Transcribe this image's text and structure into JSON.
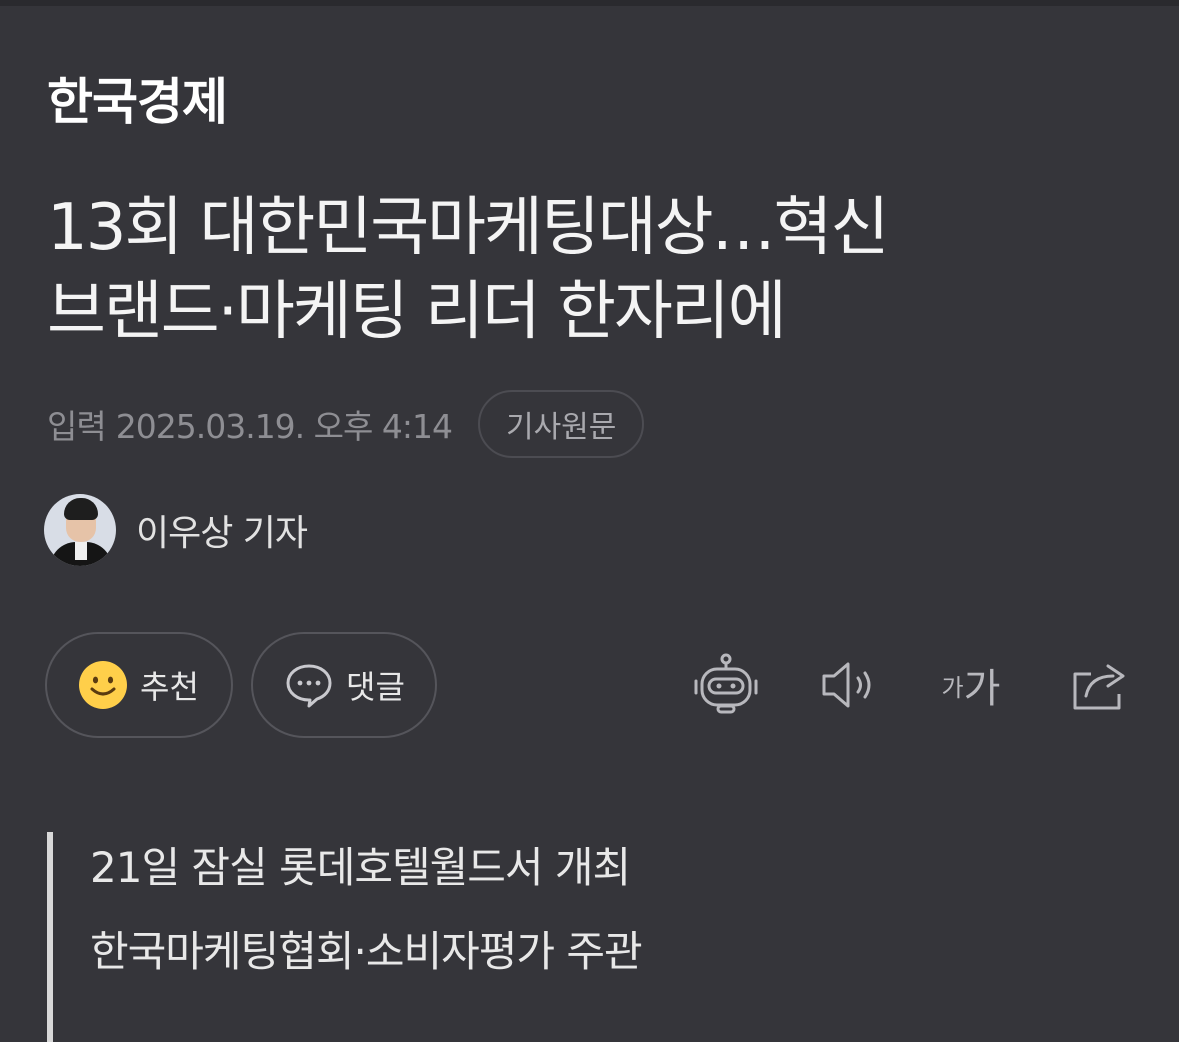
{
  "press": {
    "name": "한국경제"
  },
  "article": {
    "title_line1": "13회 대한민국마케팅대상…혁신",
    "title_line2": "브랜드·마케팅 리더 한자리에",
    "date_label": "입력",
    "date_value": "2025.03.19. 오후 4:14",
    "original_link_label": "기사원문",
    "reporter_name": "이우상 기자",
    "summary": [
      "21일 잠실 롯데호텔월드서 개최",
      "한국마케팅협회·소비자평가 주관"
    ]
  },
  "actions": {
    "recommend_label": "추천",
    "comment_label": "댓글",
    "font_size_small": "가",
    "font_size_big": "가"
  },
  "icons": {
    "recommend": "smiley-icon",
    "comment": "speech-bubble-icon",
    "summary_bot": "robot-icon",
    "tts": "speaker-icon",
    "font_size": "font-size-icon",
    "share": "share-icon"
  },
  "colors": {
    "background": "#35353a",
    "text_primary": "#f4f4f4",
    "text_meta": "#8e8e93",
    "smiley": "#ffcf4a"
  }
}
